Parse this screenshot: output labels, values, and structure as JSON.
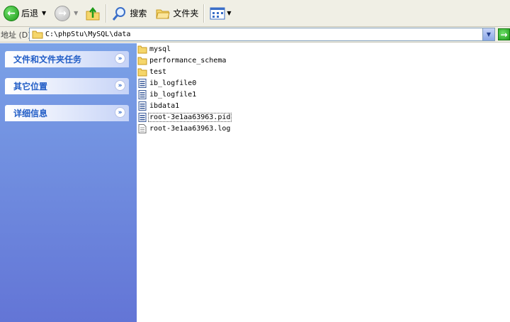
{
  "toolbar": {
    "back_label": "后退",
    "search_label": "搜索",
    "folders_label": "文件夹"
  },
  "address": {
    "label": "地址 (D)",
    "path": "C:\\phpStu\\MySQL\\data"
  },
  "task_panels": [
    {
      "title": "文件和文件夹任务"
    },
    {
      "title": "其它位置"
    },
    {
      "title": "详细信息"
    }
  ],
  "files": [
    {
      "name": "mysql",
      "icon": "folder-icon"
    },
    {
      "name": "performance_schema",
      "icon": "folder-icon"
    },
    {
      "name": "test",
      "icon": "folder-icon"
    },
    {
      "name": "ib_logfile0",
      "icon": "file-icon"
    },
    {
      "name": "ib_logfile1",
      "icon": "file-icon"
    },
    {
      "name": "ibdata1",
      "icon": "file-icon"
    },
    {
      "name": "root-3e1aa63963.pid",
      "icon": "file-icon",
      "selected": true
    },
    {
      "name": "root-3e1aa63963.log",
      "icon": "text-file-icon"
    }
  ],
  "colors": {
    "toolbar_bg": "#f0efe5",
    "taskpane_top": "#7ba2e7",
    "taskpane_bottom": "#6375d6",
    "task_title": "#215dc6",
    "folder": "#f5d66b"
  }
}
